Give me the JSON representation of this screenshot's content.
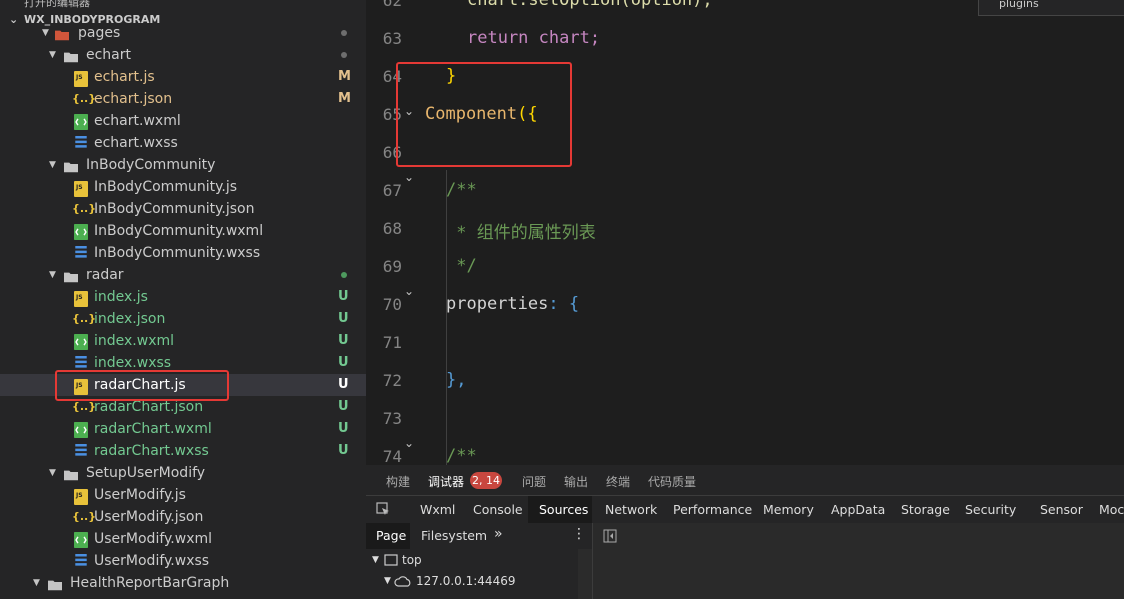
{
  "sidebar": {
    "top_partial": "打开的编辑器",
    "project_title": "WX_INBODYPROGRAM",
    "items": [
      {
        "label": "pages",
        "type": "folder-pages",
        "status": "",
        "dot": "#6e6e6e"
      },
      {
        "label": "echart",
        "type": "folder",
        "status": "",
        "dot": "#6e6e6e"
      },
      {
        "label": "echart.js",
        "type": "js",
        "status": "M"
      },
      {
        "label": "echart.json",
        "type": "json",
        "status": "M"
      },
      {
        "label": "echart.wxml",
        "type": "wxml",
        "status": ""
      },
      {
        "label": "echart.wxss",
        "type": "wxss",
        "status": ""
      },
      {
        "label": "InBodyCommunity",
        "type": "folder",
        "status": ""
      },
      {
        "label": "InBodyCommunity.js",
        "type": "js",
        "status": ""
      },
      {
        "label": "InBodyCommunity.json",
        "type": "json",
        "status": ""
      },
      {
        "label": "InBodyCommunity.wxml",
        "type": "wxml",
        "status": ""
      },
      {
        "label": "InBodyCommunity.wxss",
        "type": "wxss",
        "status": ""
      },
      {
        "label": "radar",
        "type": "folder",
        "status": "",
        "dot": "#4e9a5e"
      },
      {
        "label": "index.js",
        "type": "js",
        "status": "U"
      },
      {
        "label": "index.json",
        "type": "json",
        "status": "U"
      },
      {
        "label": "index.wxml",
        "type": "wxml",
        "status": "U"
      },
      {
        "label": "index.wxss",
        "type": "wxss",
        "status": "U"
      },
      {
        "label": "radarChart.js",
        "type": "js",
        "status": "U"
      },
      {
        "label": "radarChart.json",
        "type": "json",
        "status": "U"
      },
      {
        "label": "radarChart.wxml",
        "type": "wxml",
        "status": "U"
      },
      {
        "label": "radarChart.wxss",
        "type": "wxss",
        "status": "U"
      },
      {
        "label": "SetupUserModify",
        "type": "folder",
        "status": ""
      },
      {
        "label": "UserModify.js",
        "type": "js",
        "status": ""
      },
      {
        "label": "UserModify.json",
        "type": "json",
        "status": ""
      },
      {
        "label": "UserModify.wxml",
        "type": "wxml",
        "status": ""
      },
      {
        "label": "UserModify.wxss",
        "type": "wxss",
        "status": ""
      },
      {
        "label": "HealthReportBarGraph",
        "type": "folder",
        "status": ""
      }
    ]
  },
  "editor": {
    "search_partial": "plugins",
    "lines": [
      {
        "num": "62",
        "text": "chart.setOption(option);"
      },
      {
        "num": "63",
        "text": "return chart;"
      },
      {
        "num": "64",
        "text": "}"
      },
      {
        "num": "65",
        "text_a": "Component",
        "text_b": "({"
      },
      {
        "num": "66",
        "text": ""
      },
      {
        "num": "67",
        "text": "/**"
      },
      {
        "num": "68",
        "text": " * 组件的属性列表"
      },
      {
        "num": "69",
        "text": " */"
      },
      {
        "num": "70",
        "text_a": "properties",
        "text_b": ": {"
      },
      {
        "num": "71",
        "text": ""
      },
      {
        "num": "72",
        "text": "},"
      },
      {
        "num": "73",
        "text": ""
      },
      {
        "num": "74",
        "text": "/**"
      }
    ]
  },
  "panel": {
    "tabs": [
      "构建",
      "调试器",
      "问题",
      "输出",
      "终端",
      "代码质量"
    ],
    "badge": "2, 14",
    "devtools_tabs": [
      "Wxml",
      "Console",
      "Sources",
      "Network",
      "Performance",
      "Memory",
      "AppData",
      "Storage",
      "Security",
      "Sensor",
      "Moc"
    ],
    "sources_tabs": [
      "Page",
      "Filesystem"
    ],
    "more": "»",
    "tree": {
      "top": "top",
      "host": "127.0.0.1:44469"
    }
  },
  "colors": {
    "modified": "#e2c08d",
    "untracked": "#73c991",
    "highlight": "#e53935",
    "badge": "#c9473f"
  }
}
